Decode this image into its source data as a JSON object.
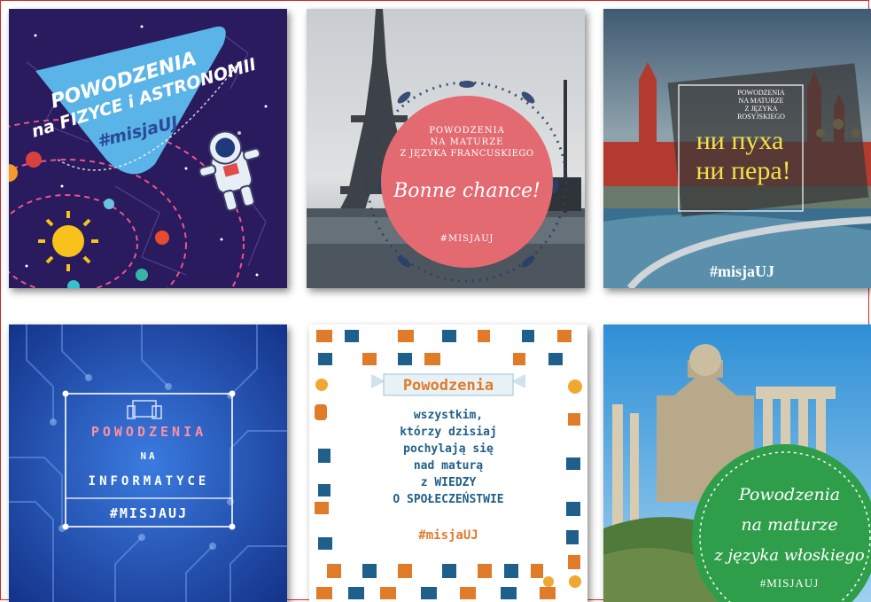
{
  "tiles": {
    "physics": {
      "line1": "POWODZENIA",
      "line2": "na FIZYCE i ASTRONOMII",
      "tag": "#misjaUJ"
    },
    "french": {
      "line1": "POWODZENIA",
      "line2": "NA MATURZE",
      "line3": "Z JĘZYKA FRANCUSKIEGO",
      "script": "Bonne chance!",
      "tag": "#MISJAUJ"
    },
    "russian": {
      "line1": "POWODZENIA",
      "line2": "NA MATURZE",
      "line3": "Z JĘZYKA",
      "line4": "ROSYJSKIEGO",
      "big1": "ни пуха",
      "big2": "ни пера!",
      "tag": "#misjaUJ"
    },
    "informatics": {
      "line1": "POWODZENIA",
      "line2": "NA",
      "line3": "INFORMATYCE",
      "tag": "#MISJAUJ"
    },
    "society": {
      "ribbon": "Powodzenia",
      "l1": "wszystkim,",
      "l2": "którzy dzisiaj",
      "l3": "pochylają się",
      "l4": "nad maturą",
      "l5": "z WIEDZY",
      "l6": "O SPOŁECZEŃSTWIE",
      "tag": "#misjaUJ"
    },
    "italian": {
      "l1": "Powodzenia",
      "l2": "na maturze",
      "l3": "z języka włoskiego",
      "tag": "#MISJAUJ"
    }
  },
  "colors": {
    "frame": "#e02020",
    "physics_bg": "#2a1a5e",
    "physics_cloud": "#5ab4e8",
    "french_circle": "#e46a72",
    "russian_sign": "#f4e04a",
    "informatics_bg": "#1f4fb0",
    "society_accent": "#e07b2a",
    "society_text": "#1f5f8b",
    "italian_circle": "#2f9e4a"
  }
}
